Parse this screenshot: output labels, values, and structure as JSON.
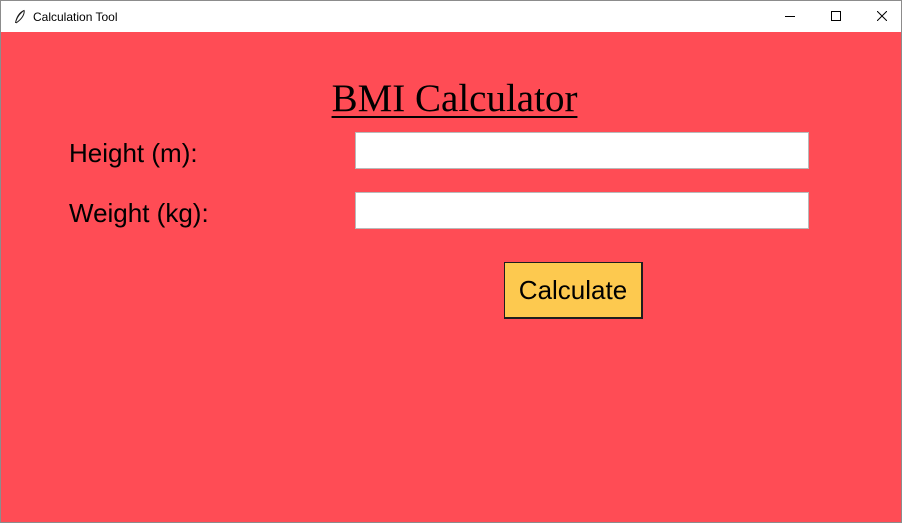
{
  "window": {
    "title": "Calculation Tool",
    "controls": {
      "minimize_icon": "minimize-icon",
      "maximize_icon": "maximize-icon",
      "close_icon": "close-icon"
    }
  },
  "form": {
    "heading": "BMI Calculator",
    "height_label": "Height (m):",
    "height_value": "",
    "weight_label": "Weight (kg):",
    "weight_value": "",
    "calculate_label": "Calculate"
  },
  "colors": {
    "background": "#ff4c55",
    "button": "#fdc94f",
    "entry": "#ffffff"
  }
}
